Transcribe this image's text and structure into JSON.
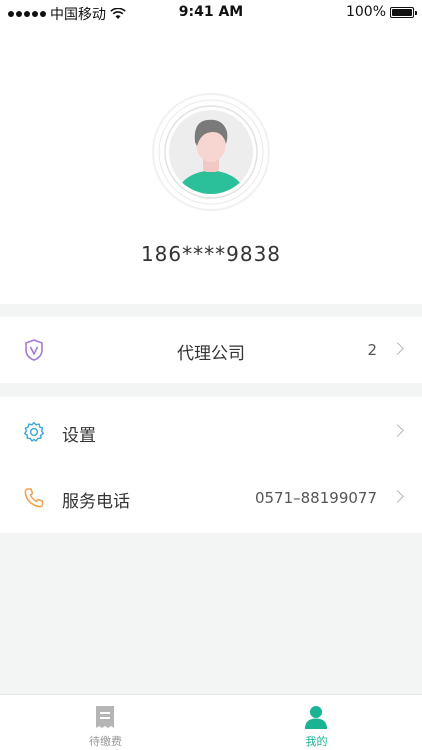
{
  "status_bar": {
    "carrier": "中国移动",
    "time": "9:41 AM",
    "battery": "100%",
    "battery_level": 1.0
  },
  "profile": {
    "phone_number": "186****9838"
  },
  "agency": {
    "label": "代理公司",
    "count": "2"
  },
  "menu": {
    "settings_label": "设置",
    "service_label": "服务电话",
    "service_phone": "0571–88199077"
  },
  "tabs": [
    {
      "label": "待缴费",
      "active": false
    },
    {
      "label": "我的",
      "active": true
    }
  ],
  "colors": {
    "accent": "#1ab394",
    "agency_icon": "#a37bd3",
    "settings_icon": "#3aa6d8",
    "phone_icon": "#f0a04b",
    "inactive_tab": "#999999"
  }
}
